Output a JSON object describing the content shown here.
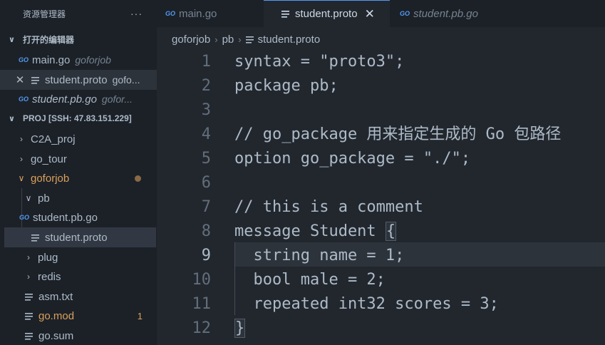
{
  "explorer": {
    "title": "资源管理器",
    "more": "···",
    "open_editors": {
      "label": "打开的编辑器",
      "items": [
        {
          "icon": "GO",
          "name": "main.go",
          "desc": "goforjob"
        },
        {
          "icon": "≡",
          "close": "✕",
          "name": "student.proto",
          "desc": "gofo..."
        },
        {
          "icon": "GO",
          "name": "student.pb.go",
          "desc": "gofor..."
        }
      ]
    },
    "project": {
      "label": "PROJ [SSH: 47.83.151.229]",
      "items": [
        {
          "name": "C2A_proj"
        },
        {
          "name": "go_tour"
        },
        {
          "name": "goforjob"
        },
        {
          "name": "pb"
        },
        {
          "name": "student.pb.go"
        },
        {
          "name": "student.proto"
        },
        {
          "name": "plug"
        },
        {
          "name": "redis"
        },
        {
          "name": "asm.txt"
        },
        {
          "name": "go.mod",
          "badge": "1"
        },
        {
          "name": "go.sum"
        }
      ]
    }
  },
  "tabs": [
    {
      "icon": "GO",
      "label": "main.go"
    },
    {
      "icon": "≡",
      "label": "student.proto",
      "close": "✕"
    },
    {
      "icon": "GO",
      "label": "student.pb.go"
    }
  ],
  "breadcrumb": {
    "items": [
      "goforjob",
      "pb",
      "student.proto"
    ],
    "sep": "›"
  },
  "editor": {
    "current_line": 9,
    "lines": [
      {
        "n": "1",
        "text": "syntax = \"proto3\";"
      },
      {
        "n": "2",
        "text": "package pb;"
      },
      {
        "n": "3",
        "text": ""
      },
      {
        "n": "4",
        "text": "// go_package 用来指定生成的 Go 包路径"
      },
      {
        "n": "5",
        "text": "option go_package = \"./\";"
      },
      {
        "n": "6",
        "text": ""
      },
      {
        "n": "7",
        "text": "// this is a comment"
      },
      {
        "n": "8",
        "text_before": "message Student ",
        "brace": "{"
      },
      {
        "n": "9",
        "text": "  string name = 1;"
      },
      {
        "n": "10",
        "text": "  bool male = 2;"
      },
      {
        "n": "11",
        "text": "  repeated int32 scores = 3;"
      },
      {
        "n": "12",
        "brace": "}"
      }
    ]
  }
}
